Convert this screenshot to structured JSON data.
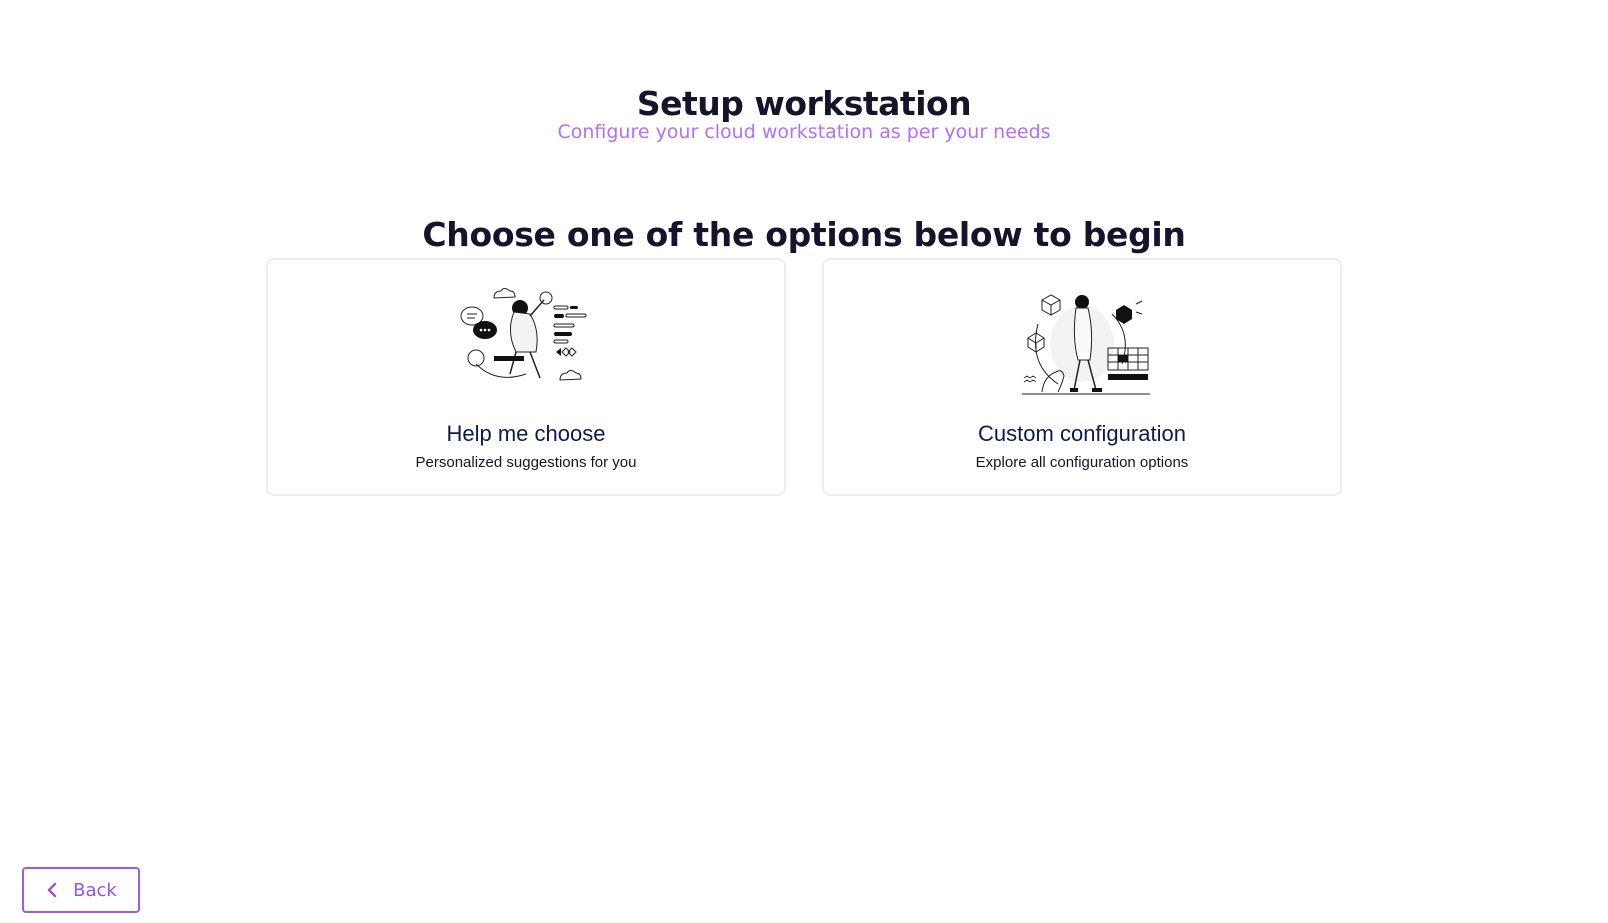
{
  "header": {
    "title": "Setup workstation",
    "subtitle": "Configure your cloud workstation as per your needs"
  },
  "section": {
    "heading": "Choose one of the options below to begin"
  },
  "options": [
    {
      "title": "Help me choose",
      "description": "Personalized suggestions for you",
      "icon": "person-chatting-illustration"
    },
    {
      "title": "Custom configuration",
      "description": "Explore all configuration options",
      "icon": "person-with-cubes-illustration"
    }
  ],
  "footer": {
    "back_label": "Back",
    "back_icon": "chevron-left-icon"
  },
  "colors": {
    "accent": "#a05ae6",
    "subtitle": "#b470ee",
    "title": "#14142b",
    "card_title": "#0e1a4d",
    "card_border": "#ececf1"
  }
}
